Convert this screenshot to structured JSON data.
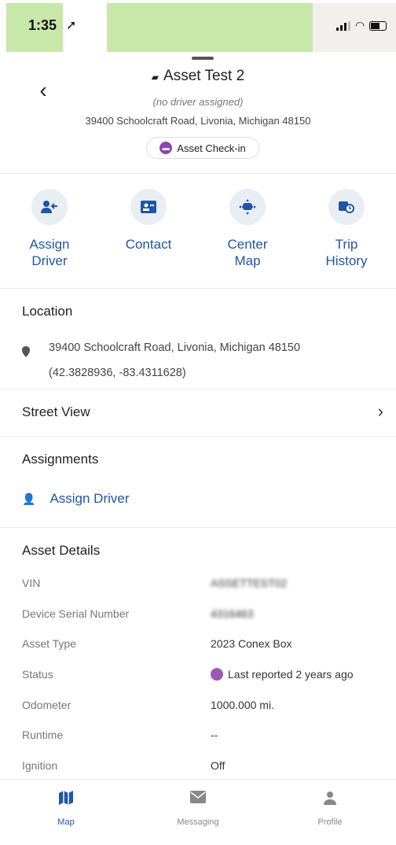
{
  "status_bar": {
    "time": "1:35",
    "location_arrow": "➚"
  },
  "header": {
    "back_label": "‹",
    "title": "Asset Test 2",
    "driver_text": "(no driver assigned)",
    "address": "39400 Schoolcraft Road, Livonia, Michigan 48150",
    "checkin_label": "Asset Check-in"
  },
  "actions": [
    {
      "label_line1": "Assign",
      "label_line2": "Driver",
      "icon": "assign-driver-icon"
    },
    {
      "label_line1": "Contact",
      "label_line2": "",
      "icon": "contact-card-icon"
    },
    {
      "label_line1": "Center",
      "label_line2": "Map",
      "icon": "center-map-icon"
    },
    {
      "label_line1": "Trip",
      "label_line2": "History",
      "icon": "trip-history-icon"
    }
  ],
  "location": {
    "title": "Location",
    "address": "39400 Schoolcraft Road, Livonia, Michigan 48150",
    "coords": "(42.3828936, -83.4311628)"
  },
  "street_view": {
    "label": "Street View"
  },
  "assignments": {
    "title": "Assignments",
    "assign_label": "Assign Driver"
  },
  "asset_details": {
    "title": "Asset Details",
    "rows": [
      {
        "key": "VIN",
        "value": "ASSETTEST02"
      },
      {
        "key": "Device Serial Number",
        "value": "4316463"
      },
      {
        "key": "Asset Type",
        "value": "2023 Conex Box"
      },
      {
        "key": "Status",
        "value": "Last reported 2 years ago"
      },
      {
        "key": "Odometer",
        "value": "1000.000 mi."
      },
      {
        "key": "Runtime",
        "value": "--"
      },
      {
        "key": "Ignition",
        "value": "Off"
      }
    ]
  },
  "tabbar": {
    "tabs": [
      {
        "label": "Map",
        "icon": "map-icon",
        "active": true
      },
      {
        "label": "Messaging",
        "icon": "envelope-icon",
        "active": false
      },
      {
        "label": "Profile",
        "icon": "person-icon",
        "active": false
      }
    ]
  },
  "colors": {
    "accent": "#1f56a8",
    "status_purple": "#9b59b6",
    "statusbar_green": "#c7e8a8"
  }
}
